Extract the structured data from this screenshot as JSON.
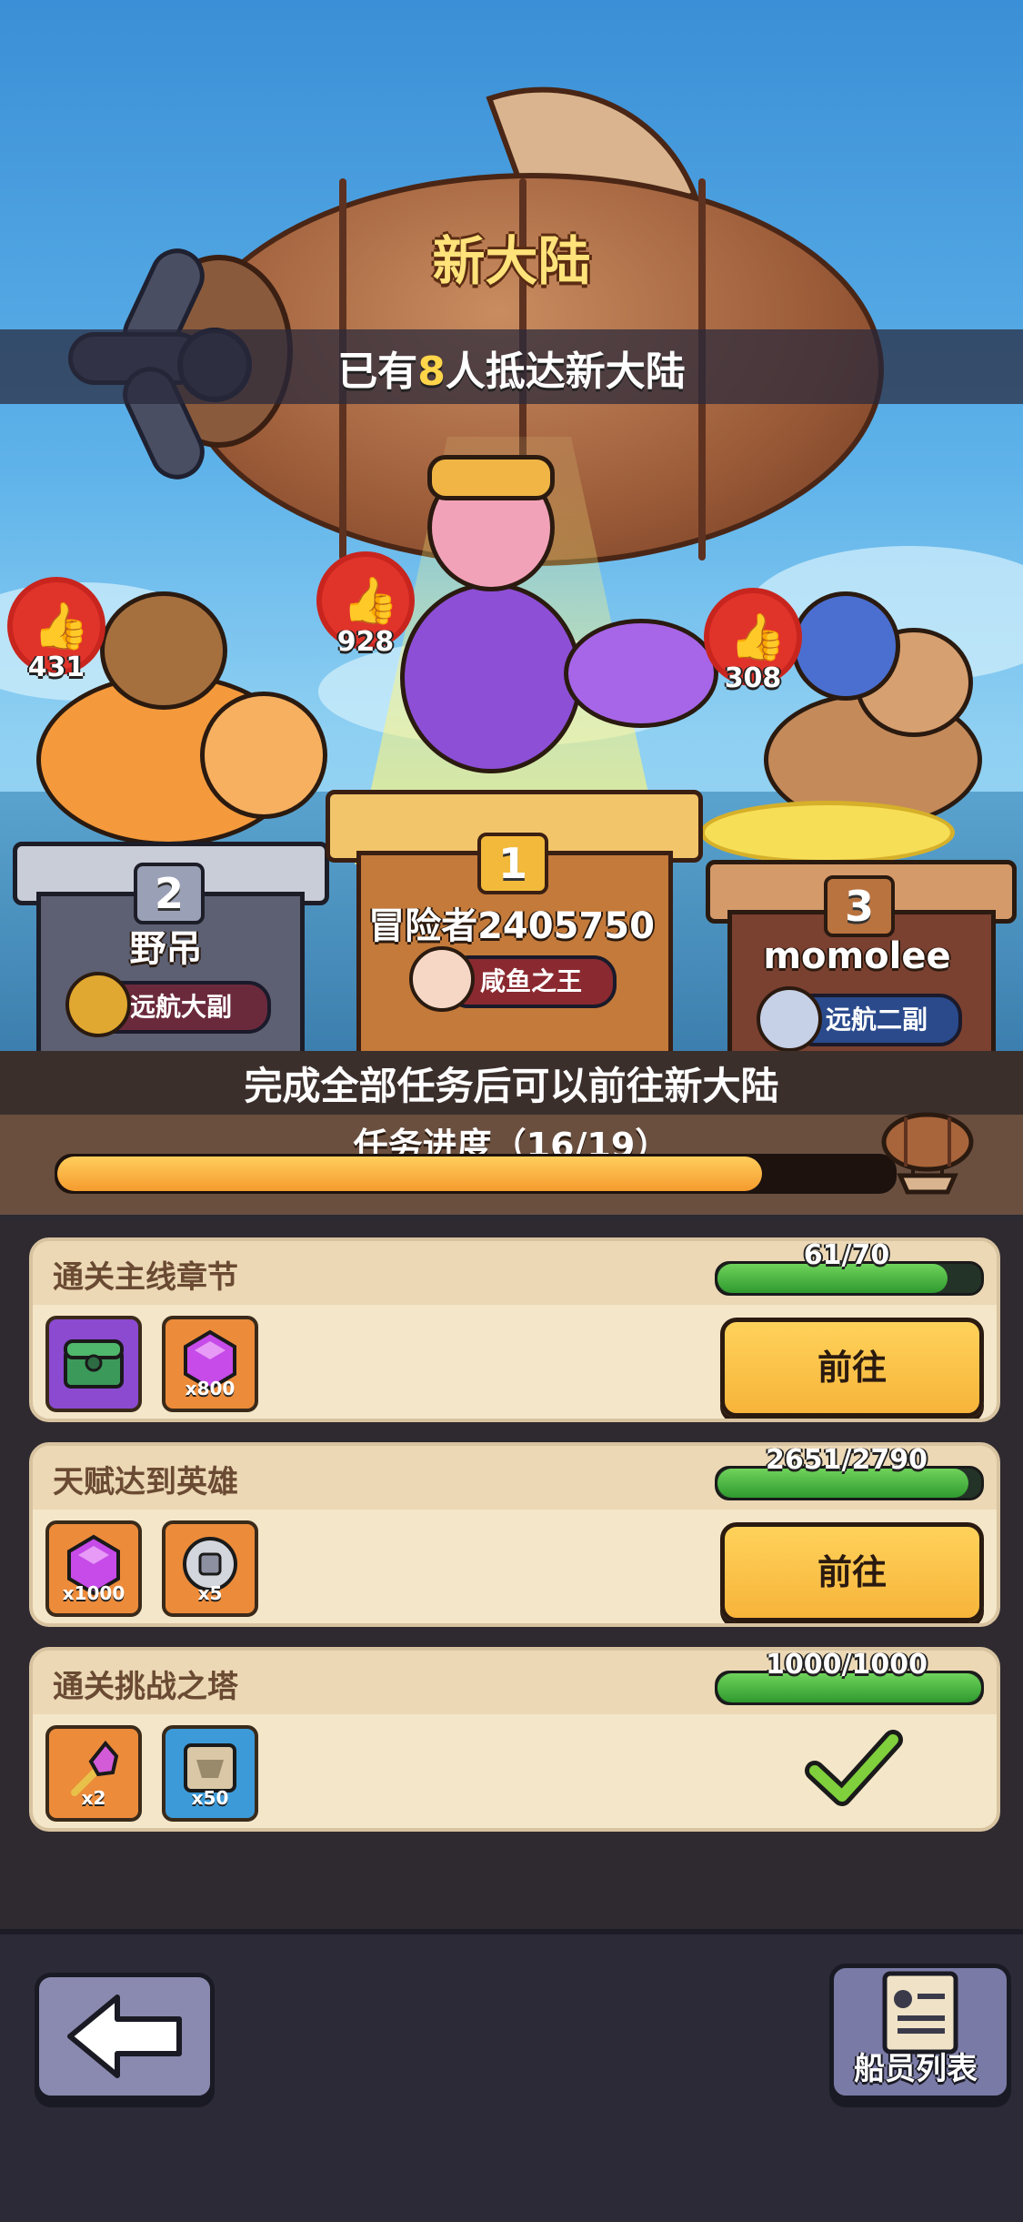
{
  "header": {
    "title": "新大陆",
    "arrival_prefix": "已有",
    "arrival_count": "8",
    "arrival_suffix": "人抵达新大陆"
  },
  "podium": [
    {
      "rank": "1",
      "name": "冒险者2405750",
      "title": "咸鱼之王",
      "likes": "928"
    },
    {
      "rank": "2",
      "name": "野吊",
      "title": "远航大副",
      "likes": "431"
    },
    {
      "rank": "3",
      "name": "momolee",
      "title": "远航二副",
      "likes": "308"
    }
  ],
  "requirement": "完成全部任务后可以前往新大陆",
  "progress": {
    "label": "任务进度（16/19）",
    "fraction": 0.842
  },
  "tasks": [
    {
      "title": "通关主线章节",
      "progress_text": "61/70",
      "fraction": 0.871,
      "rewards": [
        {
          "icon": "chest-icon",
          "qty": ""
        },
        {
          "icon": "purple-gem-icon",
          "qty": "x800"
        }
      ],
      "action": "前往",
      "completed": false
    },
    {
      "title": "天赋达到英雄",
      "progress_text": "2651/2790",
      "fraction": 0.95,
      "rewards": [
        {
          "icon": "purple-gem-icon",
          "qty": "x1000"
        },
        {
          "icon": "silver-coin-icon",
          "qty": "x5"
        }
      ],
      "action": "前往",
      "completed": false
    },
    {
      "title": "通关挑战之塔",
      "progress_text": "1000/1000",
      "fraction": 1.0,
      "rewards": [
        {
          "icon": "magic-scepter-icon",
          "qty": "x2"
        },
        {
          "icon": "blueprint-icon",
          "qty": "x50"
        }
      ],
      "action": "",
      "completed": true
    }
  ],
  "bottom": {
    "crew_list_label": "船员列表"
  },
  "colors": {
    "accent": "#f7b43a",
    "progress_green": "#2f9a2f",
    "highlight_yellow": "#ffd54a"
  }
}
